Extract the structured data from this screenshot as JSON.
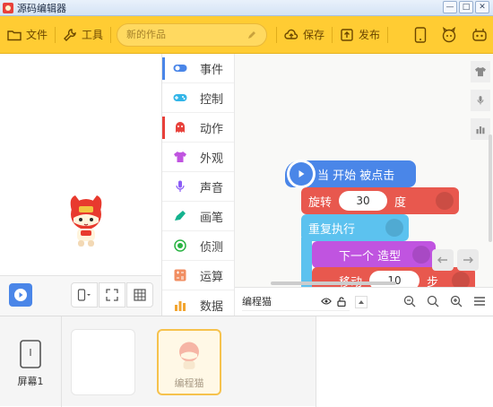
{
  "window": {
    "title": "源码编辑器",
    "minimize": "—",
    "maximize": "□",
    "close": "✕"
  },
  "toolbar": {
    "file_label": "文件",
    "tools_label": "工具",
    "project_placeholder": "新的作品",
    "save_label": "保存",
    "publish_label": "发布"
  },
  "categories": [
    {
      "label": "事件",
      "color": "#4a86e8"
    },
    {
      "label": "控制",
      "color": "#32b5e8"
    },
    {
      "label": "动作",
      "color": "#e8413b"
    },
    {
      "label": "外观",
      "color": "#c054e0"
    },
    {
      "label": "声音",
      "color": "#8b5cf6"
    },
    {
      "label": "画笔",
      "color": "#14b28e"
    },
    {
      "label": "侦测",
      "color": "#29b342"
    },
    {
      "label": "运算",
      "color": "#f18e62"
    },
    {
      "label": "数据",
      "color": "#f2a530"
    }
  ],
  "blocks": {
    "when_start": "当 开始 被点击",
    "rotate_label": "旋转",
    "rotate_value": "30",
    "rotate_unit": "度",
    "repeat_label": "重复执行",
    "next_costume": "下一个 造型",
    "move_label": "移动",
    "move_value": "10",
    "move_unit": "步"
  },
  "script_footer": {
    "sprite_name": "编程猫"
  },
  "bottom": {
    "screen_label": "屏幕1",
    "sprite_name": "编程猫"
  }
}
